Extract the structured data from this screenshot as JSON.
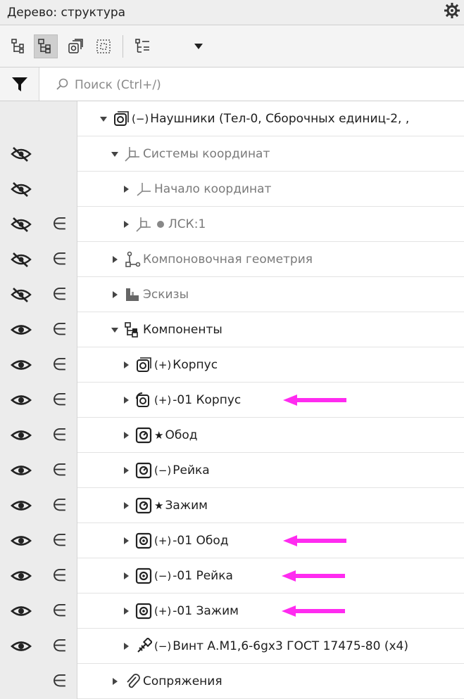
{
  "panel": {
    "title": "Дерево: структура"
  },
  "search": {
    "placeholder": "Поиск (Ctrl+/)"
  },
  "colors": {
    "arrow": "#ff2bf0",
    "header_bg": "#eeeeee",
    "gutter_bg": "#ececec"
  },
  "tree": {
    "root": {
      "mark": "(−)",
      "label": "Наушники (Тел-0, Сборочных единиц-2, ,"
    },
    "coord_systems": {
      "label": "Системы координат"
    },
    "origin": {
      "label": "Начало координат"
    },
    "lcs": {
      "label": "ЛСК:1"
    },
    "layout_geometry": {
      "label": "Компоновочная геометрия"
    },
    "sketches": {
      "label": "Эскизы"
    },
    "components": {
      "label": "Компоненты"
    },
    "korpus": {
      "mark": "(+)",
      "label": "Корпус"
    },
    "korpus01": {
      "mark": "(+)",
      "label": "-01 Корпус"
    },
    "obod": {
      "mark": "★",
      "label": "Обод"
    },
    "reyka": {
      "mark": "(−)",
      "label": "Рейка"
    },
    "zazhim": {
      "mark": "★",
      "label": "Зажим"
    },
    "obod01": {
      "mark": "(+)",
      "label": "-01 Обод"
    },
    "reyka01": {
      "mark": "(−)",
      "label": "-01 Рейка"
    },
    "zazhim01": {
      "mark": "(+)",
      "label": "-01 Зажим"
    },
    "screw": {
      "mark": "(−)",
      "label": "Винт А.М1,6-6gx3 ГОСТ 17475-80 (x4)"
    },
    "mates": {
      "label": "Сопряжения"
    }
  },
  "gutter": {
    "include_symbol": "∈"
  }
}
